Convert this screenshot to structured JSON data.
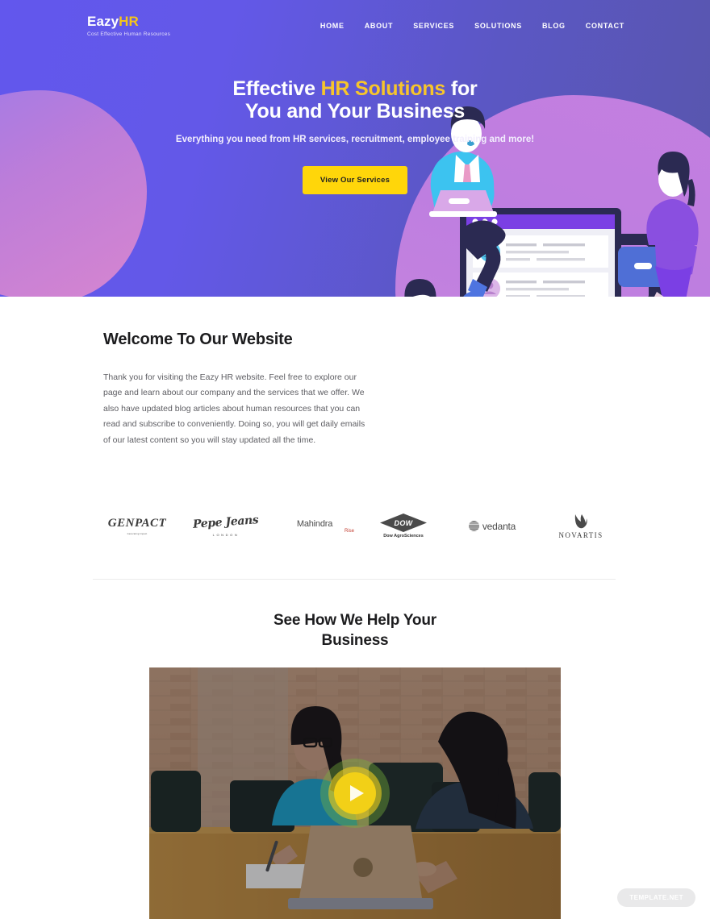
{
  "header": {
    "logo_main": "Eazy",
    "logo_accent": "HR",
    "logo_tagline": "Cost Effective Human Resources",
    "nav": [
      {
        "label": "HOME"
      },
      {
        "label": "ABOUT"
      },
      {
        "label": "SERVICES"
      },
      {
        "label": "SOLUTIONS"
      },
      {
        "label": "BLOG"
      },
      {
        "label": "CONTACT"
      }
    ]
  },
  "hero": {
    "title_part1": "Effective ",
    "title_accent": "HR Solutions",
    "title_part2": " for",
    "title_line2": "You and Your Business",
    "subtitle": "Everything you need from HR services, recruitment, employee training and more!",
    "cta_label": "View Our Services",
    "bg_gradient_start": "#6257ED",
    "bg_gradient_end": "#5856AB",
    "accent_color": "#F7C52B",
    "cta_color": "#FFD60A",
    "blob_color": "#C27FD8"
  },
  "welcome": {
    "title": "Welcome To Our Website",
    "body": "Thank you for visiting the Eazy HR website. Feel free to explore our page and learn about our company and the services that we offer. We also have updated blog articles about human resources that you can read and subscribe to conveniently. Doing so, you will get daily emails of our latest content so you will stay updated all the time."
  },
  "clients": [
    {
      "name": "GENPACT",
      "sub": "Generating Impact"
    },
    {
      "name": "Pepe Jeans",
      "sub": "LONDON"
    },
    {
      "name": "Mahindra",
      "sub": "Rise"
    },
    {
      "name": "DOW",
      "sub": "Dow AgroSciences"
    },
    {
      "name": "vedanta",
      "sub": ""
    },
    {
      "name": "NOVARTIS",
      "sub": ""
    }
  ],
  "help_section": {
    "title_line1": "See How We Help Your",
    "title_line2": "Business",
    "video_alt": "Two women in a business meeting at a conference table with a laptop",
    "play_label": "Play video"
  },
  "watermark": {
    "label_bold": "TEMPLATE",
    "label_light": ".NET"
  }
}
